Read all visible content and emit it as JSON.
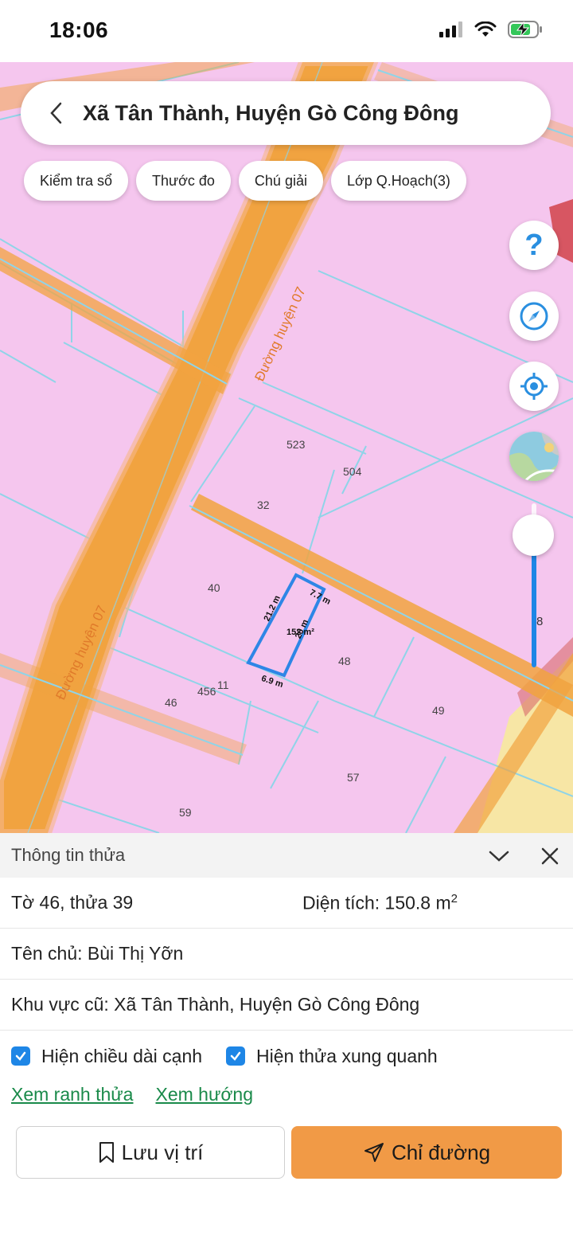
{
  "status_bar": {
    "time": "18:06"
  },
  "header": {
    "title": "Xã Tân Thành, Huyện Gò Công Đông"
  },
  "chips": [
    "Kiểm tra sổ",
    "Thước đo",
    "Chú giải",
    "Lớp Q.Hoạch(3)"
  ],
  "map": {
    "zoom_level": "8",
    "zoom_fraction": 0.7,
    "road_labels": [
      "Đường huyện 07",
      "Đường huyện 07"
    ],
    "plot_labels": [
      "523",
      "504",
      "32",
      "40",
      "48",
      "456",
      "11",
      "46",
      "49",
      "57",
      "59"
    ],
    "selected_plot": {
      "area": "152 m²",
      "edges": [
        "21.2 m",
        "7.7 m",
        "20 m",
        "6.9 m"
      ]
    },
    "colors": {
      "residential": "#f5c6ee",
      "road": "#f1a340",
      "boundary": "#2e86e6",
      "parcel_line": "#8fd4e8"
    }
  },
  "sheet": {
    "title": "Thông tin thửa",
    "sheet_parcel": "Tờ 46, thửa 39",
    "area_label": "Diện tích: 150.8 m",
    "area_sup": "2",
    "owner": "Tên chủ: Bùi Thị Yỡn",
    "old_area": "Khu vực cũ: Xã Tân Thành, Huyện Gò Công Đông",
    "check_edges": "Hiện chiều dài cạnh",
    "check_neighbors": "Hiện thửa xung quanh",
    "link_boundary": "Xem ranh thửa",
    "link_direction": "Xem hướng",
    "save_label": "Lưu vị trí",
    "route_label": "Chỉ đường"
  }
}
